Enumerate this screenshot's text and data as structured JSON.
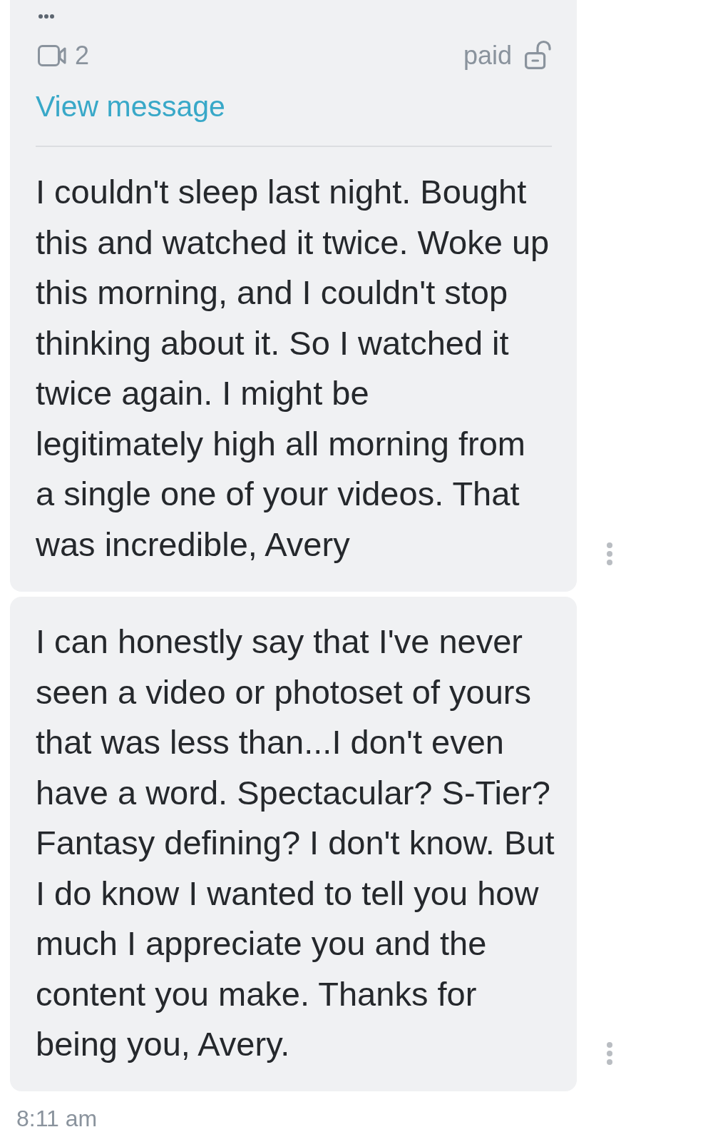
{
  "messages": [
    {
      "header": {
        "media_count": "2",
        "price_label": "paid",
        "locked": false
      },
      "link": "View message",
      "lines": [
        "I couldn't sleep last night. Bought",
        "this and watched it twice. Woke up",
        "this morning, and I couldn't stop",
        "thinking about it. So I watched it",
        "twice again. I might be",
        "legitimately high all morning from",
        "a single one of your videos. That",
        "was incredible, Avery"
      ]
    },
    {
      "lines": [
        "I can honestly say that I've never",
        "seen a video or photoset of yours",
        "that was less than...I don't even",
        "have a word. Spectacular? S-Tier?",
        "Fantasy defining? I don't know. But",
        "I do know I wanted to tell you how",
        "much I appreciate you and the",
        "content you make. Thanks for",
        "being you, Avery."
      ]
    }
  ],
  "footer": {
    "time": "8:11 am"
  }
}
